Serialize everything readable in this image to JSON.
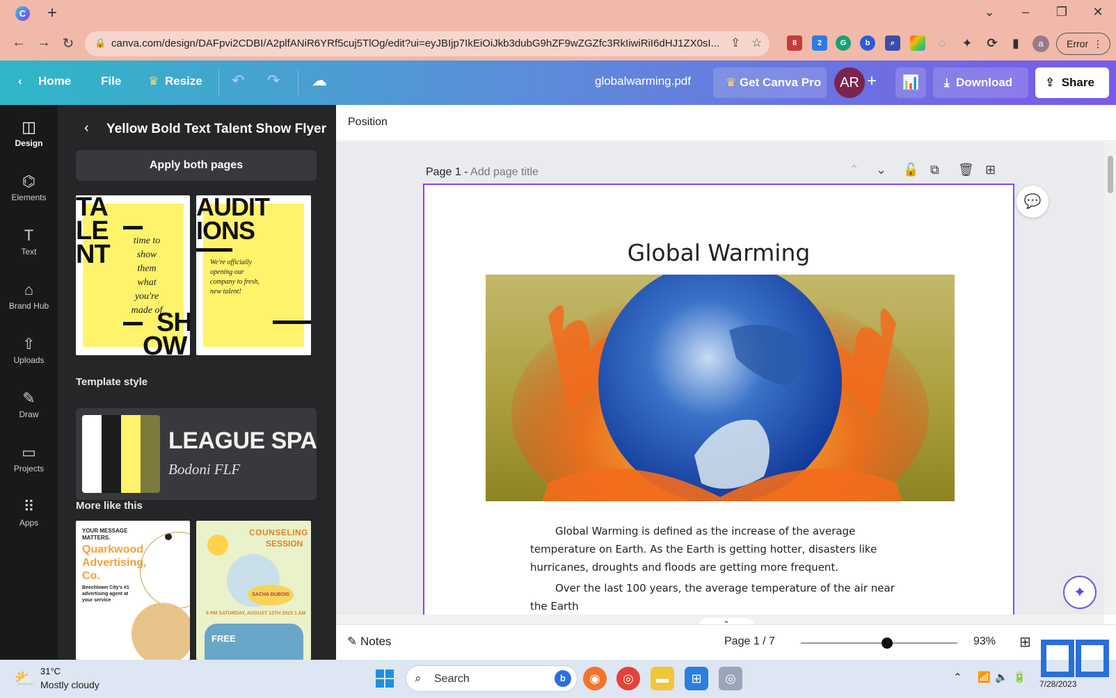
{
  "browser": {
    "url": "canva.com/design/DAFpvi2CDBI/A2plfANiR6YRf5cuj5TlOg/edit?ui=eyJBIjp7IkEiOiJkb3dubG9hZF9wZGZfc3RkIiwiRiI6dHJ1ZX0sI...",
    "error_label": "Error",
    "profile_initial": "a",
    "ext_badge_1": "8",
    "ext_badge_2": "2"
  },
  "header": {
    "home": "Home",
    "file": "File",
    "resize": "Resize",
    "doc_name": "globalwarming.pdf",
    "get_pro": "Get Canva Pro",
    "avatar_initials": "AR",
    "download": "Download",
    "share": "Share"
  },
  "rail": {
    "items": [
      {
        "label": "Design",
        "icon": "layout-icon"
      },
      {
        "label": "Elements",
        "icon": "shapes-icon"
      },
      {
        "label": "Text",
        "icon": "text-icon"
      },
      {
        "label": "Brand Hub",
        "icon": "brand-icon"
      },
      {
        "label": "Uploads",
        "icon": "upload-icon"
      },
      {
        "label": "Draw",
        "icon": "draw-icon"
      },
      {
        "label": "Projects",
        "icon": "folder-icon"
      },
      {
        "label": "Apps",
        "icon": "apps-icon"
      }
    ]
  },
  "panel": {
    "title": "Yellow Bold Text Talent Show Flyer",
    "apply_btn": "Apply both pages",
    "template_style_label": "Template style",
    "font_primary": "LEAGUE SPAR",
    "font_secondary": "Bodoni FLF",
    "swatches": [
      "#ffffff",
      "#1c1c1c",
      "#fff36b",
      "#7c7a3c"
    ],
    "more_like_label": "More like this",
    "thumb1": {
      "big_text": [
        "TA",
        "LE",
        "NT"
      ],
      "script_lines": [
        "time to",
        "show",
        "them",
        "what",
        "you're",
        "made of"
      ],
      "bottom_text": [
        "SH",
        "OW"
      ]
    },
    "thumb2": {
      "big_text": [
        "AUDIT",
        "IONS"
      ],
      "script_lines": [
        "We're officially",
        "opening our",
        "company to fresh,",
        "new talent!"
      ]
    },
    "thumb3": {
      "kicker": "YOUR MESSAGE MATTERS.",
      "title": "Quarkwood Advertising, Co.",
      "desc": "Beechtown City's #1 advertising agent at your service"
    },
    "thumb4": {
      "title_line1": "COUNSELING",
      "title_line2": "SESSION",
      "speaker": "SACHA DUBOIS",
      "date_line": "9 PM  SATURDAY, AUGUST 12TH 2023  1 AM",
      "free": "FREE"
    }
  },
  "canvas": {
    "position_label": "Position",
    "page_label": "Page 1 -",
    "page_title_placeholder": "Add page title",
    "doc_title": "Global Warming",
    "para1": "Global Warming is defined as the increase of the average temperature on Earth. As the Earth is getting hotter, disasters like hurricanes, droughts and floods are getting more frequent.",
    "para2": "Over the last 100 years, the average temperature of the air near the Earth"
  },
  "footer": {
    "notes": "Notes",
    "page_count": "Page 1 / 7",
    "zoom": "93%",
    "zoom_fraction": 0.55
  },
  "taskbar": {
    "temp": "31°C",
    "weather": "Mostly cloudy",
    "search": "Search",
    "date": "7/28/2023"
  }
}
